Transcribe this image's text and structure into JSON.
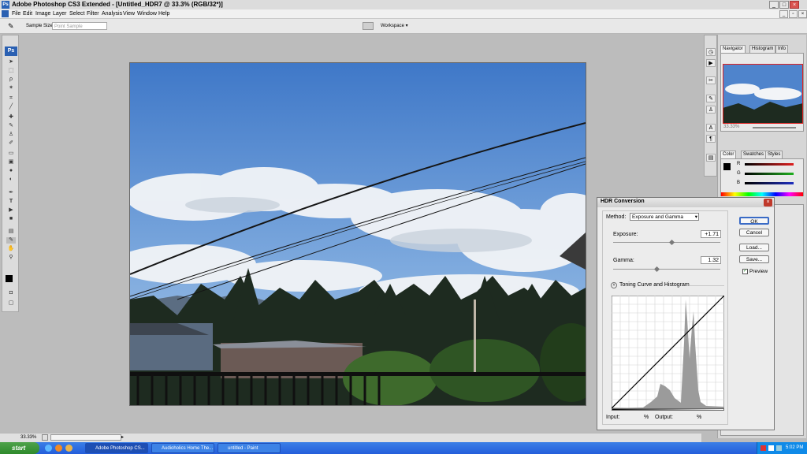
{
  "window": {
    "title": "Adobe Photoshop CS3 Extended - [Untitled_HDR7 @ 33.3% (RGB/32*)]"
  },
  "menu": [
    "File",
    "Edit",
    "Image",
    "Layer",
    "Select",
    "Filter",
    "Analysis",
    "View",
    "Window",
    "Help"
  ],
  "options_bar": {
    "sample_size_label": "Sample Size:",
    "sample_size_value": "Point Sample",
    "workspace_label": "Workspace ▾"
  },
  "toolbox": {
    "logo": "Ps"
  },
  "panels": {
    "tabs": [
      "Navigator",
      "Histogram",
      "Info"
    ],
    "zoom": "33.33%",
    "color_tabs": [
      "Color",
      "Swatches",
      "Styles"
    ],
    "color_labels": [
      "R",
      "G",
      "B"
    ]
  },
  "hdr_dialog": {
    "title": "HDR Conversion",
    "method_label": "Method:",
    "method_value": "Exposure and Gamma",
    "exposure_label": "Exposure:",
    "exposure_value": "+1.71",
    "gamma_label": "Gamma:",
    "gamma_value": "1.32",
    "toning_label": "Toning Curve and Histogram",
    "input_label": "Input:",
    "output_label": "Output:",
    "percent": "%",
    "buttons": {
      "ok": "OK",
      "cancel": "Cancel",
      "load": "Load...",
      "save": "Save..."
    },
    "preview_label": "Preview",
    "preview_checked": true
  },
  "statusbar": {
    "zoom": "33.33%"
  },
  "taskbar": {
    "start": "start",
    "items": [
      "Adobe Photoshop CS...",
      "Audioholics Home The...",
      "untitled - Paint"
    ],
    "clock": "5:02 PM"
  },
  "colors": {
    "sky_top": "#3f78c8",
    "sky_bottom": "#8ab4df",
    "ps_blue": "#2a60b2",
    "xp_taskbar": "#245edb"
  }
}
